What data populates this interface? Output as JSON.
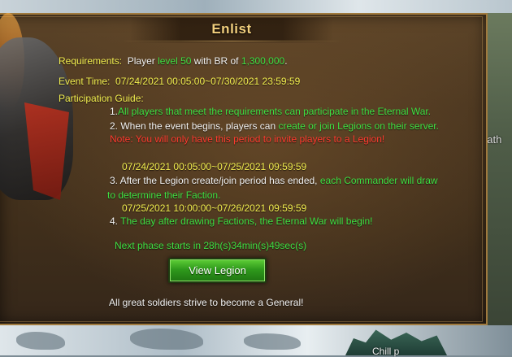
{
  "panel": {
    "title": "Enlist",
    "requirements": {
      "label": "Requirements:",
      "pre": "Player ",
      "level": "level 50",
      "mid": " with BR of ",
      "br": "1,300,000",
      "post": "."
    },
    "event_time": {
      "label": "Event Time:",
      "value": "07/24/2021 00:05:00~07/30/2021 23:59:59"
    },
    "guide": {
      "label": "Participation Guide:",
      "item1_num": "1.",
      "item1_text": "All players that meet the requirements can participate in the Eternal War.",
      "item2_pre": "2. When the event begins, players can ",
      "item2_hl": "create or join Legions on their server.",
      "note": "Note: You will only have this period to invite players to a Legion!",
      "period1": "07/24/2021 00:05:00~07/25/2021 09:59:59",
      "item3_pre": "3. After the Legion create/join period has ended, ",
      "item3_hl_a": "each Commander will draw",
      "item3_hl_b": "to determine their Faction.",
      "period2": "07/25/2021 10:00:00~07/26/2021 09:59:59",
      "item4_num": "4. ",
      "item4_text": "The day after drawing Factions, the Eternal War will begin!"
    },
    "next_phase": "Next phase starts in 28h(s)34min(s)49sec(s)",
    "button_label": "View Legion",
    "footer": "All great soldiers strive to become a General!"
  },
  "background": {
    "right_label": "eath",
    "castle_label": "Chill p"
  },
  "colors": {
    "label_yellow": "#f2ee4f",
    "highlight_green": "#3ee043",
    "note_red": "#ff3b2f",
    "title_gold": "#f2cf7d",
    "button_green": "#2f9a1c"
  }
}
